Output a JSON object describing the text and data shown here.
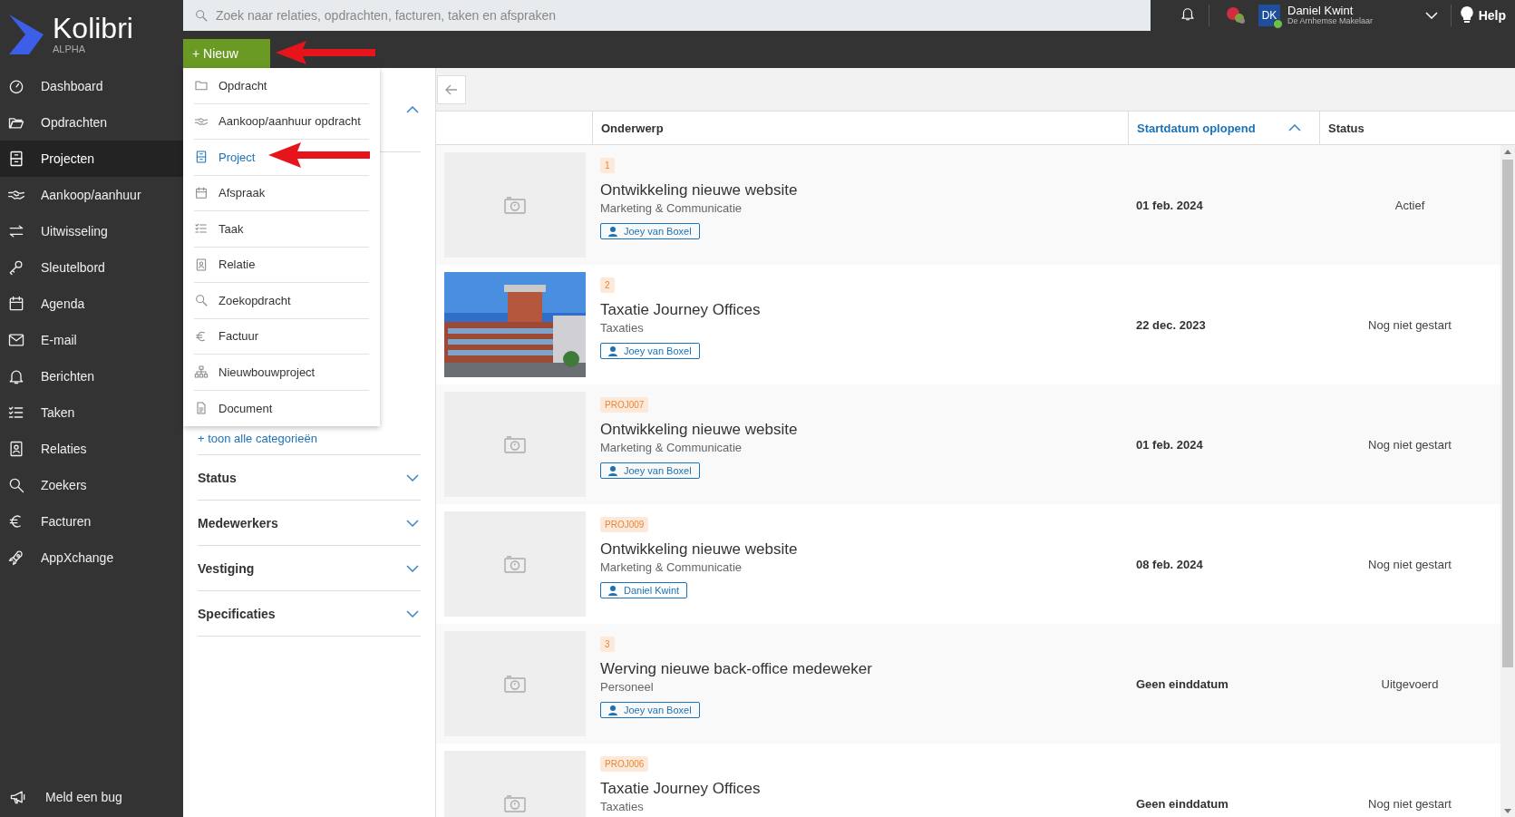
{
  "app": {
    "name": "Kolibri",
    "tag": "ALPHA"
  },
  "sidebar": {
    "items": [
      {
        "label": "Dashboard",
        "selected": false
      },
      {
        "label": "Opdrachten",
        "selected": false
      },
      {
        "label": "Projecten",
        "selected": true
      },
      {
        "label": "Aankoop/aanhuur",
        "selected": false
      },
      {
        "label": "Uitwisseling",
        "selected": false
      },
      {
        "label": "Sleutelbord",
        "selected": false
      },
      {
        "label": "Agenda",
        "selected": false
      },
      {
        "label": "E-mail",
        "selected": false
      },
      {
        "label": "Berichten",
        "selected": false
      },
      {
        "label": "Taken",
        "selected": false
      },
      {
        "label": "Relaties",
        "selected": false
      },
      {
        "label": "Zoekers",
        "selected": false
      },
      {
        "label": "Facturen",
        "selected": false
      },
      {
        "label": "AppXchange",
        "selected": false
      }
    ],
    "footer": "Meld een bug"
  },
  "topbar": {
    "search": {
      "placeholder": "Zoek naar relaties, opdrachten, facturen, taken en afspraken"
    },
    "user": {
      "initials": "DK",
      "name": "Daniel Kwint",
      "company": "De Arnhemse Makelaar",
      "online": true
    },
    "help": "Help",
    "new_button": "+ Nieuw"
  },
  "new_menu": {
    "items": [
      {
        "label": "Opdracht",
        "selected": false
      },
      {
        "label": "Aankoop/aanhuur opdracht",
        "selected": false
      },
      {
        "label": "Project",
        "selected": true
      },
      {
        "label": "Afspraak",
        "selected": false
      },
      {
        "label": "Taak",
        "selected": false
      },
      {
        "label": "Relatie",
        "selected": false
      },
      {
        "label": "Zoekopdracht",
        "selected": false
      },
      {
        "label": "Factuur",
        "selected": false
      },
      {
        "label": "Nieuwbouwproject",
        "selected": false
      },
      {
        "label": "Document",
        "selected": false
      }
    ]
  },
  "filters": {
    "top_section": {
      "expanded": true
    },
    "show_all": "+ toon alle categorieën",
    "sections": [
      {
        "label": "Status",
        "expanded": false
      },
      {
        "label": "Medewerkers",
        "expanded": false
      },
      {
        "label": "Vestiging",
        "expanded": false
      },
      {
        "label": "Specificaties",
        "expanded": false
      }
    ]
  },
  "table": {
    "columns": [
      {
        "label": "Onderwerp",
        "sorted": false
      },
      {
        "label": "Startdatum oplopend",
        "sorted": true
      },
      {
        "label": "Status",
        "sorted": false
      }
    ],
    "rows": [
      {
        "thumbnail": {
          "kind": "placeholder"
        },
        "code": "1",
        "title": "Ontwikkeling nieuwe website",
        "category": "Marketing & Communicatie",
        "assignee": "Joey van Boxel",
        "date": "01 feb. 2024",
        "status": "Actief"
      },
      {
        "code": "2",
        "title": "Taxatie Journey Offices",
        "category": "Taxaties",
        "assignee": "Joey van Boxel",
        "date": "22 dec. 2023",
        "status": "Nog niet gestart"
      },
      {
        "thumbnail": {
          "kind": "placeholder"
        },
        "code": "PROJ007",
        "title": "Ontwikkeling nieuwe website",
        "category": "Marketing & Communicatie",
        "assignee": "Joey van Boxel",
        "date": "01 feb. 2024",
        "status": "Nog niet gestart"
      },
      {
        "thumbnail": {
          "kind": "placeholder"
        },
        "code": "PROJ009",
        "title": "Ontwikkeling nieuwe website",
        "category": "Marketing & Communicatie",
        "assignee": "Daniel Kwint",
        "date": "08 feb. 2024",
        "status": "Nog niet gestart"
      },
      {
        "thumbnail": {
          "kind": "placeholder"
        },
        "code": "3",
        "title": "Werving nieuwe back-office medeweker",
        "category": "Personeel",
        "assignee": "Joey van Boxel",
        "date": "Geen einddatum",
        "status": "Uitgevoerd"
      },
      {
        "thumbnail": {
          "kind": "placeholder"
        },
        "code": "PROJ006",
        "title": "Taxatie Journey Offices",
        "category": "Taxaties",
        "date": "Geen einddatum",
        "status": "Nog niet gestart"
      }
    ]
  }
}
